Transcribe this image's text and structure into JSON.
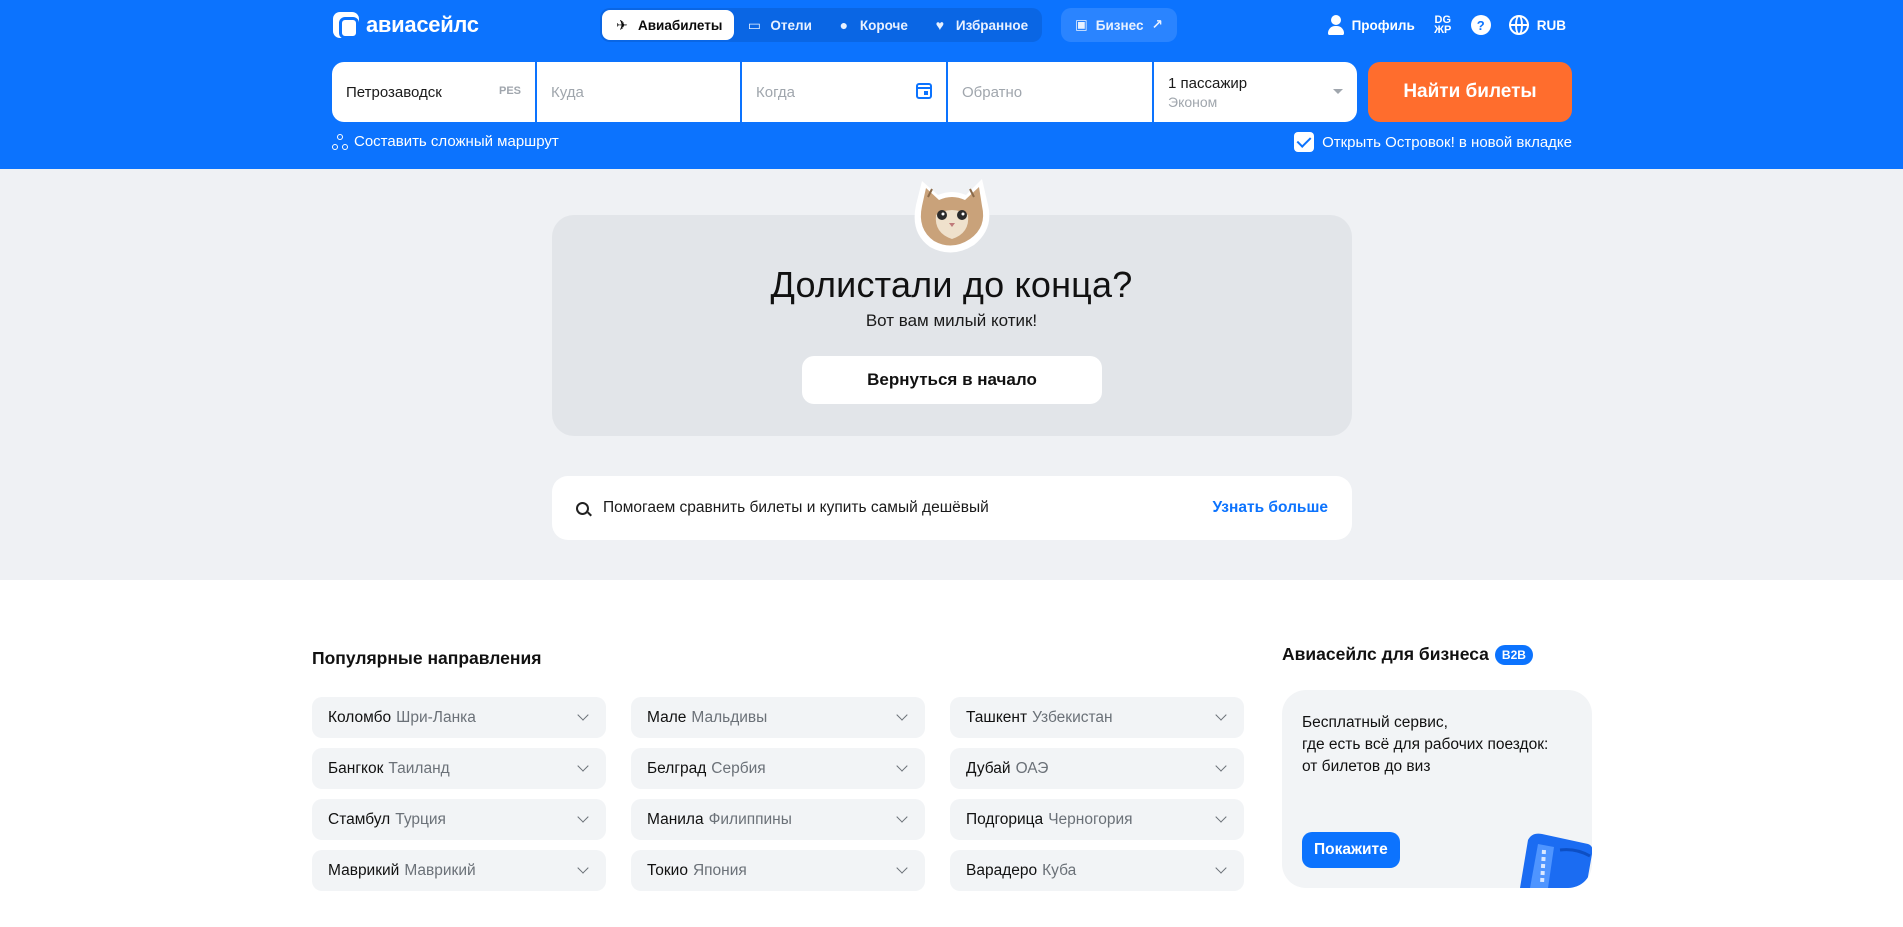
{
  "header": {
    "logo_text": "авиасейлс",
    "tabs": [
      {
        "label": "Авиабилеты",
        "icon": "plane-icon",
        "active": true
      },
      {
        "label": "Отели",
        "icon": "bed-icon",
        "active": false
      },
      {
        "label": "Короче",
        "icon": "pin-icon",
        "active": false
      },
      {
        "label": "Избранное",
        "icon": "heart-icon",
        "active": false
      }
    ],
    "business_label": "Бизнес",
    "profile_label": "Профиль",
    "dark_mode_label": "DG\nЖР",
    "help_label": "?",
    "currency": "RUB"
  },
  "search": {
    "from_value": "Петрозаводск",
    "from_iata": "PES",
    "to_placeholder": "Куда",
    "when_placeholder": "Когда",
    "back_placeholder": "Обратно",
    "passengers": "1 пассажир",
    "cabin_class": "Эконом",
    "find_button": "Найти билеты",
    "complex_route": "Составить сложный маршрут",
    "open_tab_label": "Открыть Островок! в новой вкладке",
    "open_tab_checked": true
  },
  "end_block": {
    "title": "Долистали до конца?",
    "subtitle": "Вот вам милый котик!",
    "back_button": "Вернуться в начало"
  },
  "info_bar": {
    "text": "Помогаем сравнить билеты и купить самый дешёвый",
    "link": "Узнать больше"
  },
  "popular": {
    "title": "Популярные направления",
    "items": [
      {
        "city": "Коломбо",
        "country": "Шри-Ланка"
      },
      {
        "city": "Мале",
        "country": "Мальдивы"
      },
      {
        "city": "Ташкент",
        "country": "Узбекистан"
      },
      {
        "city": "Бангкок",
        "country": "Таиланд"
      },
      {
        "city": "Белград",
        "country": "Сербия"
      },
      {
        "city": "Дубай",
        "country": "ОАЭ"
      },
      {
        "city": "Стамбул",
        "country": "Турция"
      },
      {
        "city": "Манила",
        "country": "Филиппины"
      },
      {
        "city": "Подгорица",
        "country": "Черногория"
      },
      {
        "city": "Маврикий",
        "country": "Маврикий"
      },
      {
        "city": "Токио",
        "country": "Япония"
      },
      {
        "city": "Варадеро",
        "country": "Куба"
      }
    ]
  },
  "business": {
    "title": "Авиасейлс для бизнеса",
    "badge": "B2B",
    "text": "Бесплатный сервис,\nгде есть всё для рабочих поездок:\nот билетов до виз",
    "button": "Покажите"
  },
  "colors": {
    "brand_blue": "#0c73fe",
    "find_orange": "#ff6d2d",
    "grey_bg": "#eff1f4"
  }
}
